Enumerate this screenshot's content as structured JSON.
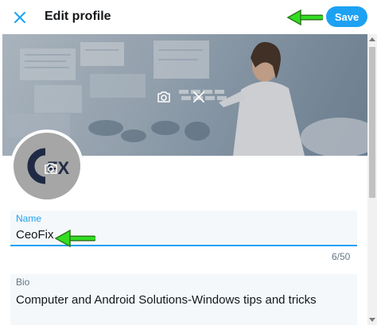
{
  "header": {
    "title": "Edit profile",
    "save_label": "Save"
  },
  "name_field": {
    "label": "Name",
    "value": "CeoFix",
    "counter": "6/50"
  },
  "bio_field": {
    "label": "Bio",
    "value": "Computer and Android Solutions-Windows tips and tricks"
  },
  "colors": {
    "accent": "#1da1f2",
    "arrow": "#22cc22",
    "field_bg": "#f5f8fa",
    "muted": "#657786"
  },
  "icons": {
    "close": "close-icon",
    "camera": "camera-icon",
    "remove": "close-icon",
    "arrow": "arrow-left-icon"
  }
}
